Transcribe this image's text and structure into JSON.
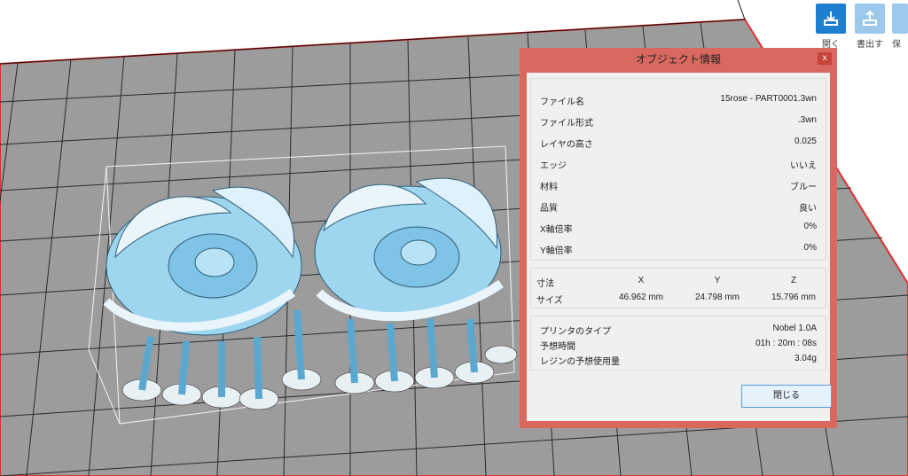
{
  "toolbar": {
    "open_label": "開く",
    "export_label": "書出す",
    "save_label": "保"
  },
  "dialog": {
    "title": "オブジェクト情報",
    "close_x": "x",
    "info": {
      "file_name_label": "ファイル名",
      "file_name_value": "15rose - PART0001.3wn",
      "file_format_label": "ファイル形式",
      "file_format_value": ".3wn",
      "layer_height_label": "レイヤの高さ",
      "layer_height_value": "0.025",
      "edge_label": "エッジ",
      "edge_value": "いいえ",
      "material_label": "材料",
      "material_value": "ブルー",
      "quality_label": "品質",
      "quality_value": "良い",
      "x_scale_label": "X軸倍率",
      "x_scale_value": "0%",
      "y_scale_label": "Y軸倍率",
      "y_scale_value": "0%"
    },
    "dims": {
      "header_label": "寸法",
      "x_header": "X",
      "y_header": "Y",
      "z_header": "Z",
      "size_label": "サイズ",
      "x_value": "46.962 mm",
      "y_value": "24.798 mm",
      "z_value": "15.796 mm"
    },
    "printer": {
      "type_label": "プリンタのタイプ",
      "type_value": "Nobel 1.0A",
      "time_label": "予想時間",
      "time_value": "01h : 20m : 08s",
      "resin_label": "レジンの予想使用量",
      "resin_value": "3.04g"
    },
    "close_button_label": "閉じる"
  },
  "colors": {
    "dialog_frame": "#d9695f",
    "platform": "#9a9a9a",
    "platform_border": "#e03030",
    "model_fill": "#8fd0f0"
  }
}
